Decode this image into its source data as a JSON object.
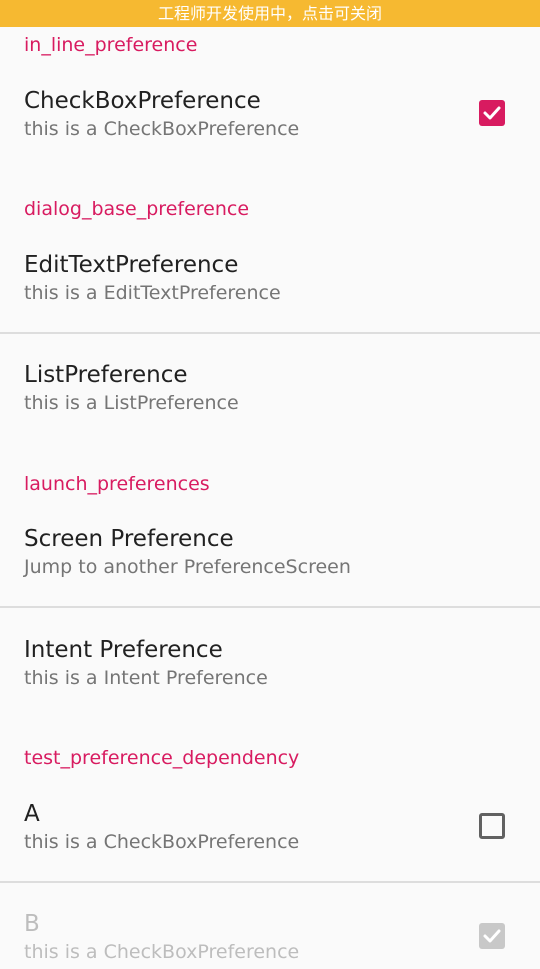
{
  "banner": {
    "text": "工程师开发使用中，点击可关闭"
  },
  "categories": {
    "in_line": "in_line_preference",
    "dialog_base": "dialog_base_preference",
    "launch": "launch_preferences",
    "dependency": "test_preference_dependency"
  },
  "prefs": {
    "checkbox": {
      "title": "CheckBoxPreference",
      "summary": "this is a CheckBoxPreference",
      "checked": true
    },
    "edittext": {
      "title": "EditTextPreference",
      "summary": "this is a EditTextPreference"
    },
    "list": {
      "title": "ListPreference",
      "summary": "this is a ListPreference"
    },
    "screen": {
      "title": "Screen Preference",
      "summary": "Jump to another PreferenceScreen"
    },
    "intent": {
      "title": "Intent Preference",
      "summary": "this is a Intent Preference"
    },
    "a": {
      "title": "A",
      "summary": "this is a CheckBoxPreference",
      "checked": false
    },
    "b": {
      "title": "B",
      "summary": "this is a CheckBoxPreference",
      "checked": true,
      "enabled": false
    }
  },
  "colors": {
    "accent": "#d81b60",
    "banner": "#f6b931",
    "background": "#fafafa"
  }
}
